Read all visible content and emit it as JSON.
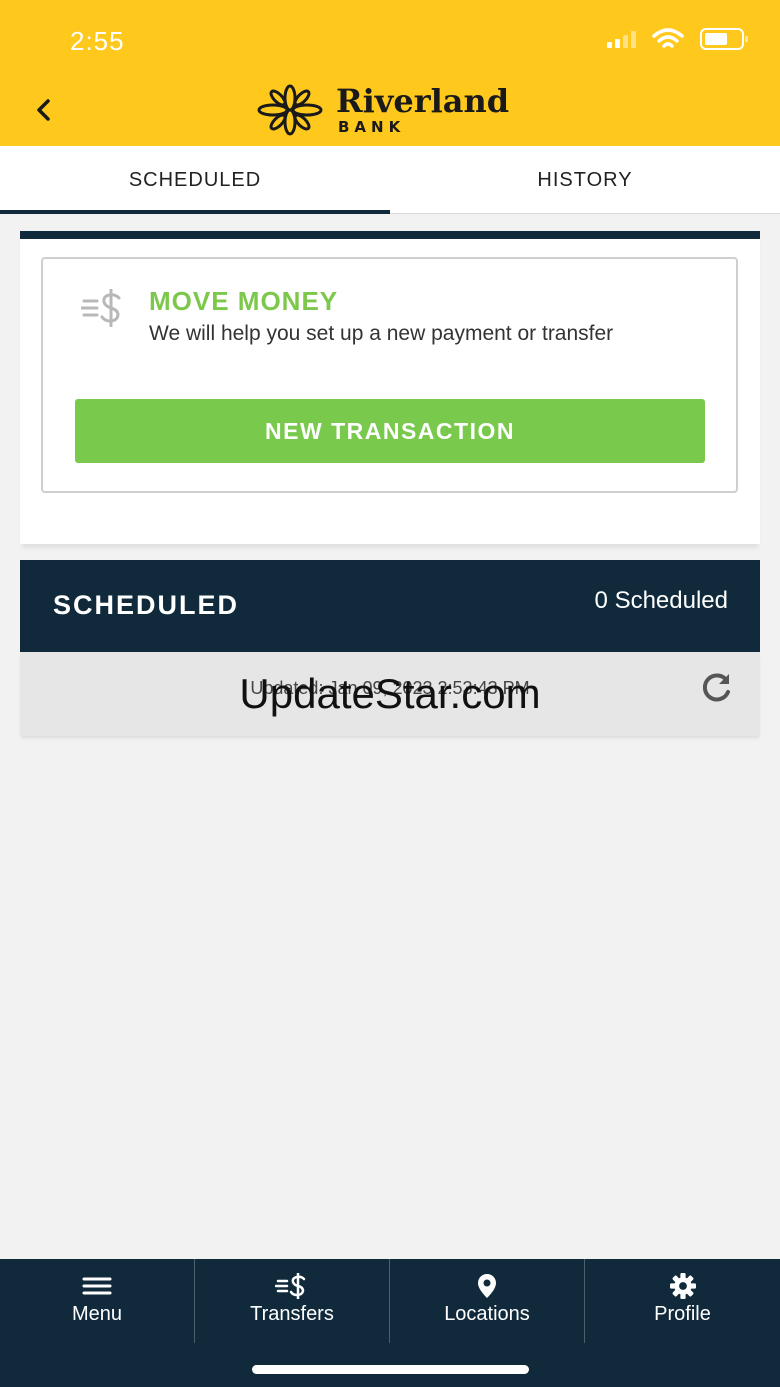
{
  "status_bar": {
    "time": "2:55"
  },
  "header": {
    "logo_name": "Riverland",
    "logo_sub": "BANK",
    "brand_color": "#fec81d"
  },
  "tabs": [
    {
      "label": "SCHEDULED",
      "active": true
    },
    {
      "label": "HISTORY",
      "active": false
    }
  ],
  "move_money": {
    "icon": "dollar-transfer-icon",
    "title": "MOVE MONEY",
    "description": "We will help you set up a new payment or transfer",
    "button_label": "NEW TRANSACTION",
    "accent_color": "#78c94c"
  },
  "scheduled": {
    "title": "SCHEDULED",
    "count_label": "0 Scheduled",
    "updated_text": "Updated: Jan 09, 2023 2:53:43 PM"
  },
  "watermark": "UpdateStar.com",
  "bottom_nav": [
    {
      "label": "Menu",
      "icon": "menu-icon"
    },
    {
      "label": "Transfers",
      "icon": "transfers-icon"
    },
    {
      "label": "Locations",
      "icon": "location-pin-icon"
    },
    {
      "label": "Profile",
      "icon": "gear-icon"
    }
  ],
  "colors": {
    "navy": "#102a3c"
  }
}
